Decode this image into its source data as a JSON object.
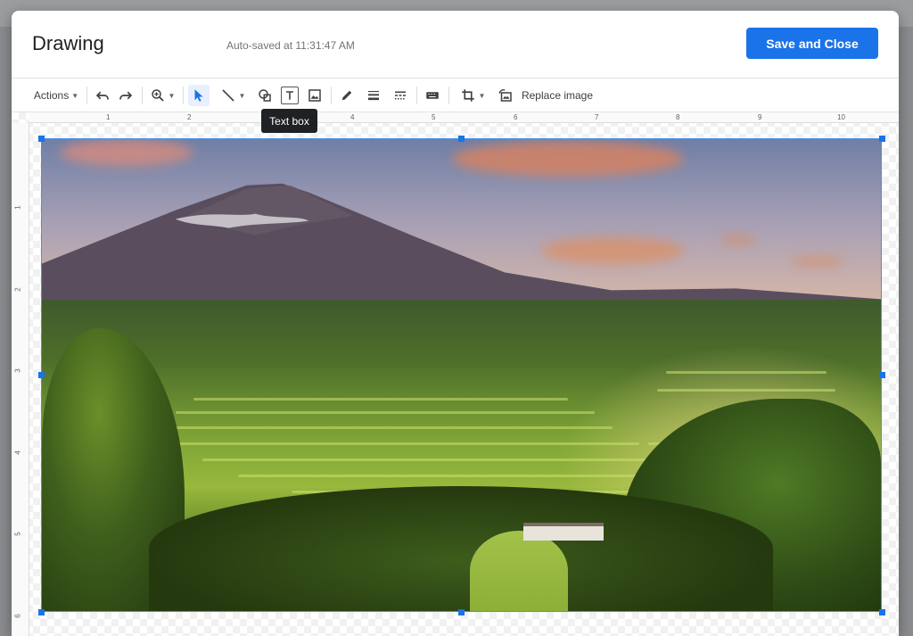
{
  "dialog": {
    "title": "Drawing",
    "autosave": "Auto-saved at 11:31:47 AM",
    "save_label": "Save and Close"
  },
  "toolbar": {
    "actions_label": "Actions",
    "replace_label": "Replace image",
    "tooltip": "Text box",
    "icons": [
      "undo-icon",
      "redo-icon",
      "zoom-icon",
      "select-icon",
      "line-icon",
      "shape-icon",
      "text-box-icon",
      "image-icon",
      "pen-icon",
      "line-weight-icon",
      "line-dash-icon",
      "alt-text-icon",
      "crop-icon",
      "reset-image-icon"
    ]
  },
  "ruler": {
    "horizontal": [
      "1",
      "2",
      "3",
      "4",
      "5",
      "6",
      "7",
      "8",
      "9",
      "10"
    ],
    "vertical": [
      "1",
      "2",
      "3",
      "4",
      "5",
      "6"
    ]
  },
  "colors": {
    "accent": "#1a73e8",
    "tooltip_bg": "#202124"
  }
}
